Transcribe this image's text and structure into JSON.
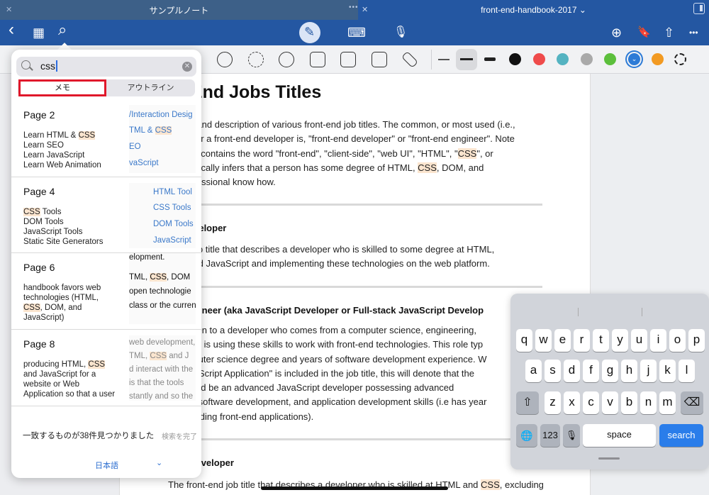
{
  "tabs": {
    "left_title": "サンプルノート",
    "right_title": "front-end-handbook-2017",
    "right_chevron": "⌄",
    "close": "✕",
    "dots": "•••"
  },
  "toolbar": {
    "back": "‹",
    "grid": "▦",
    "search": "⌕",
    "pen": "✎",
    "keyboard": "⌨",
    "mic": "🎙",
    "add_page": "⊕",
    "bookmark": "🔖",
    "share": "⇧",
    "more": "•••"
  },
  "colors": {
    "accent": "#2457a2",
    "swatches": [
      "#111111",
      "#ef4b4b",
      "#54b3c1",
      "#a9a9a9",
      "#5cbf3c",
      "#2d7bd6",
      "#f29a22"
    ]
  },
  "search": {
    "query": "css",
    "clear": "✕",
    "seg_memo": "メモ",
    "seg_outline": "アウトライン"
  },
  "results": [
    {
      "page": "Page 2",
      "lines": [
        "Learn HTML & ",
        "CSS",
        "\nLearn SEO\nLearn JavaScript\nLearn Web Animation"
      ],
      "thumb": [
        "/Interaction Desig",
        "TML & ",
        "CSS",
        "EO",
        "vaScript"
      ]
    },
    {
      "page": "Page 4",
      "lines": [
        "CSS",
        " Tools\nDOM Tools\nJavaScript Tools\nStatic Site Generators"
      ],
      "thumb": [
        "HTML Tool",
        "CSS Tools",
        "DOM Tools",
        "JavaScript"
      ]
    },
    {
      "page": "Page 6",
      "lines": [
        "handbook favors web\ntechnologies (HTML,\n",
        "CSS",
        ", DOM, and\nJavaScript)"
      ],
      "thumb": [
        "elopment.",
        "TML, ",
        "CSS",
        ", DOM",
        "open technologie",
        "class or the curren"
      ]
    },
    {
      "page": "Page 8",
      "lines": [
        "producing HTML, ",
        "CSS",
        "\nand JavaScript for a\nwebsite or Web\nApplication so that a user"
      ],
      "thumb": [
        "web development,",
        "TML, ",
        "CSS",
        " and J",
        "d interact with the",
        "is that the tools",
        "stantly and so the"
      ]
    }
  ],
  "footer": {
    "count": "一致するものが38件見つかりました",
    "done": "検索を完了",
    "lang": "日本語",
    "chev": "⌄"
  },
  "doc": {
    "title": "nt-End Jobs Titles",
    "intro": [
      "s a list and description of various front-end job titles. The common, or most used (i.e.,",
      "), title for a front-end developer is, \"front-end developer\" or \"front-end engineer\". Note",
      " job that contains the word \"front-end\", \"client-side\", \"web UI\", \"HTML\", \"",
      "CSS",
      "\", or",
      "ript\" typically infers that a person has some degree of HTML, ",
      "CSS",
      ", DOM, and",
      "ipt professional know how."
    ],
    "h1": "nd Developer",
    "p1": [
      "neric job title that describes a developer who is skilled to some degree at HTML,",
      "OM, and JavaScript and implementing these technologies on the web platform."
    ],
    "h2": "nd Engineer (aka JavaScript Developer or Full-stack JavaScript Develop",
    "p2": [
      "title given to a developer who comes from a computer science, engineering,",
      "und and is using these skills to work with front-end technologies. This role typ",
      " a computer science degree and years of software development experience. W",
      "d \"JavaScript Application\" is included in the job title, this will denote that the",
      "er should be an advanced JavaScript developer possessing advanced",
      "nming, software development, and application development skills (i.e has year",
      "nce building front-end applications)."
    ],
    "h3": "TML Developer",
    "p3": [
      "The front-end job title that describes a developer who is skilled at HTML and ",
      "CSS",
      ", excluding"
    ]
  },
  "keyboard": {
    "row1": [
      "q",
      "w",
      "e",
      "r",
      "t",
      "y",
      "u",
      "i",
      "o",
      "p"
    ],
    "row2": [
      "a",
      "s",
      "d",
      "f",
      "g",
      "h",
      "j",
      "k",
      "l"
    ],
    "row3": [
      "z",
      "x",
      "c",
      "v",
      "b",
      "n",
      "m"
    ],
    "shift": "⇧",
    "delete": "⌫",
    "globe": "🌐",
    "num": "123",
    "mic": "🎙",
    "space": "space",
    "search": "search"
  }
}
